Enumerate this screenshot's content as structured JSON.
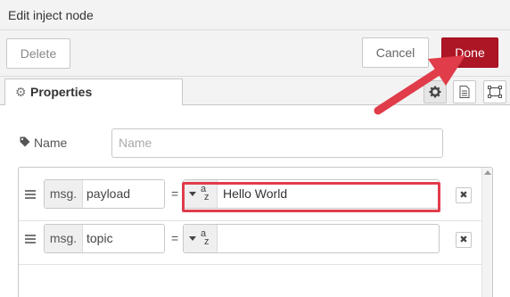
{
  "dialog": {
    "title": "Edit inject node"
  },
  "toolbar": {
    "delete_label": "Delete",
    "cancel_label": "Cancel",
    "done_label": "Done"
  },
  "tabs": {
    "properties_label": "Properties",
    "icons": [
      "gear-icon",
      "document-icon",
      "frame-icon"
    ]
  },
  "form": {
    "name_label": "Name",
    "name_placeholder": "Name"
  },
  "properties": [
    {
      "prefix": "msg.",
      "field": "payload",
      "operator": "=",
      "type_icon": "string-az-icon",
      "value": "Hello World"
    },
    {
      "prefix": "msg.",
      "field": "topic",
      "operator": "=",
      "type_icon": "string-az-icon",
      "value": ""
    }
  ],
  "colors": {
    "done_button": "#ad1625",
    "annotation": "#e03c4a"
  }
}
